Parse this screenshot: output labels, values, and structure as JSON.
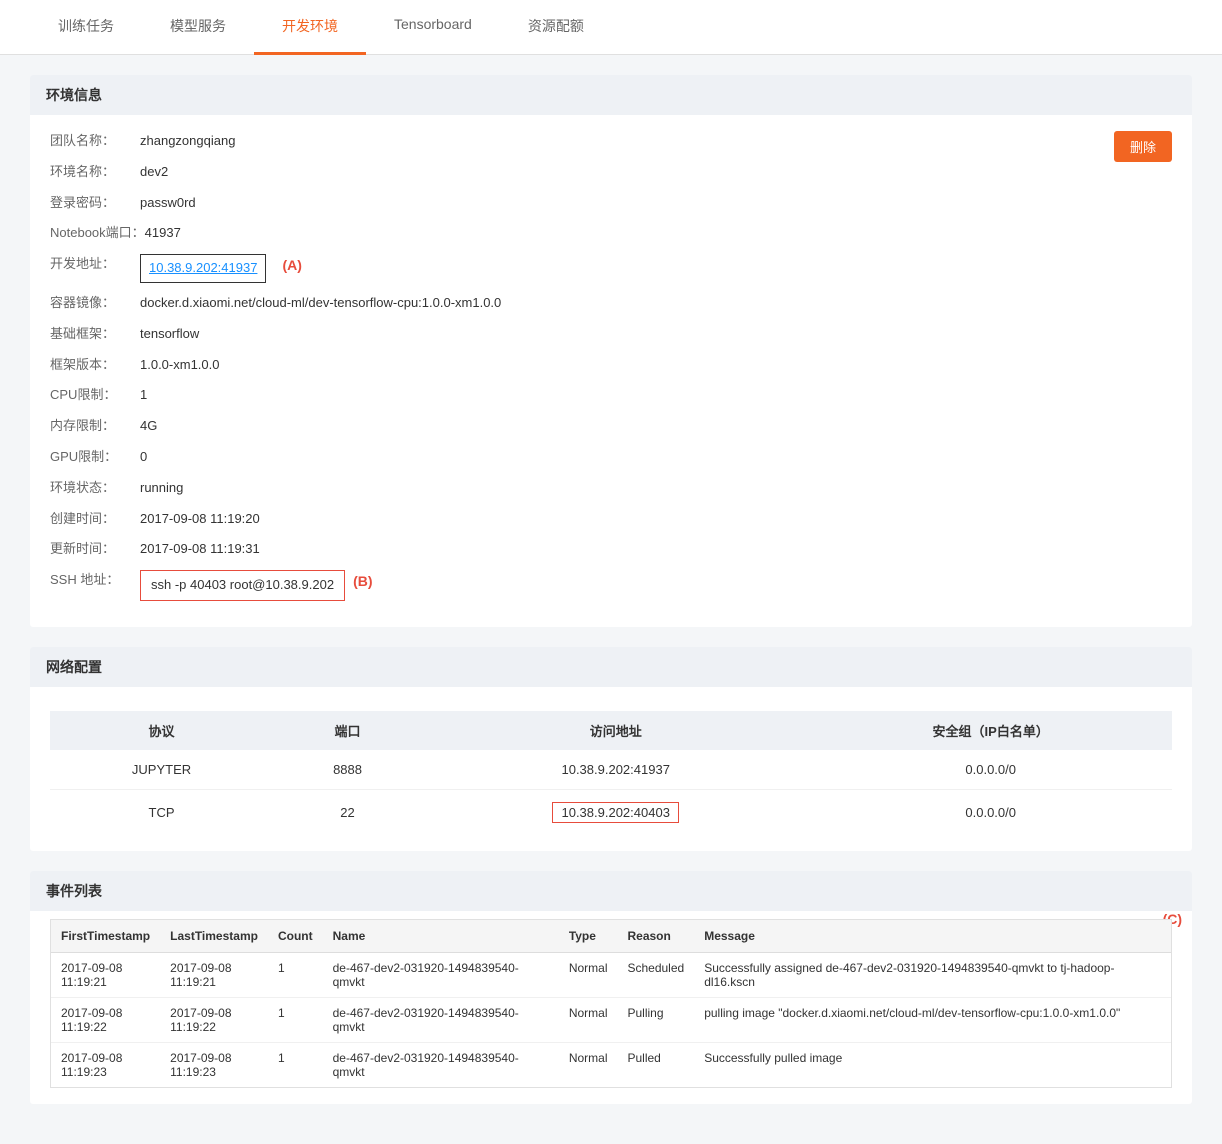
{
  "tabs": [
    {
      "id": "train",
      "label": "训练任务",
      "active": false
    },
    {
      "id": "model",
      "label": "模型服务",
      "active": false
    },
    {
      "id": "dev",
      "label": "开发环境",
      "active": true
    },
    {
      "id": "tensorboard",
      "label": "Tensorboard",
      "active": false
    },
    {
      "id": "resource",
      "label": "资源配额",
      "active": false
    }
  ],
  "sections": {
    "env_info": {
      "header": "环境信息",
      "delete_btn": "删除",
      "fields": [
        {
          "label": "团队名称：",
          "value": "zhangzongqiang"
        },
        {
          "label": "环境名称：",
          "value": "dev2"
        },
        {
          "label": "登录密码：",
          "value": "passw0rd"
        },
        {
          "label": "Notebook端口：",
          "value": "41937"
        },
        {
          "label": "开发地址：",
          "value": "10.38.9.202:41937",
          "type": "link_box",
          "annotation": "(A)"
        },
        {
          "label": "容器镜像：",
          "value": "docker.d.xiaomi.net/cloud-ml/dev-tensorflow-cpu:1.0.0-xm1.0.0"
        },
        {
          "label": "基础框架：",
          "value": "tensorflow"
        },
        {
          "label": "框架版本：",
          "value": "1.0.0-xm1.0.0"
        },
        {
          "label": "CPU限制：",
          "value": "1"
        },
        {
          "label": "内存限制：",
          "value": "4G"
        },
        {
          "label": "GPU限制：",
          "value": "0"
        },
        {
          "label": "环境状态：",
          "value": "running"
        },
        {
          "label": "创建时间：",
          "value": "2017-09-08 11:19:20"
        },
        {
          "label": "更新时间：",
          "value": "2017-09-08 11:19:31"
        },
        {
          "label": "SSH 地址：",
          "value": "ssh -p 40403 root@10.38.9.202",
          "type": "ssh_box",
          "annotation": "(B)"
        }
      ]
    },
    "network": {
      "header": "网络配置",
      "table": {
        "columns": [
          "协议",
          "端口",
          "访问地址",
          "安全组（IP白名单）"
        ],
        "rows": [
          {
            "protocol": "JUPYTER",
            "port": "8888",
            "address": "10.38.9.202:41937",
            "security": "0.0.0.0/0",
            "address_boxed": false
          },
          {
            "protocol": "TCP",
            "port": "22",
            "address": "10.38.9.202:40403",
            "security": "0.0.0.0/0",
            "address_boxed": true
          }
        ]
      }
    },
    "events": {
      "header": "事件列表",
      "annotation_c": "(C)",
      "table": {
        "columns": [
          "FirstTimestamp",
          "LastTimestamp",
          "Count",
          "Name",
          "Type",
          "Reason",
          "Message"
        ],
        "rows": [
          {
            "first": "2017-09-08\n11:19:21",
            "last": "2017-09-08\n11:19:21",
            "count": "1",
            "name": "de-467-dev2-031920-1494839540-qmvkt",
            "type": "Normal",
            "reason": "Scheduled",
            "message": "Successfully assigned de-467-dev2-031920-1494839540-qmvkt to tj-hadoop-dl16.kscn"
          },
          {
            "first": "2017-09-08\n11:19:22",
            "last": "2017-09-08\n11:19:22",
            "count": "1",
            "name": "de-467-dev2-031920-1494839540-qmvkt",
            "type": "Normal",
            "reason": "Pulling",
            "message": "pulling image \"docker.d.xiaomi.net/cloud-ml/dev-tensorflow-cpu:1.0.0-xm1.0.0\""
          },
          {
            "first": "2017-09-08\n11:19:23",
            "last": "2017-09-08\n11:19:23",
            "count": "1",
            "name": "de-467-dev2-031920-1494839540-qmvkt",
            "type": "Normal",
            "reason": "Pulled",
            "message": "Successfully pulled image"
          }
        ]
      }
    }
  }
}
